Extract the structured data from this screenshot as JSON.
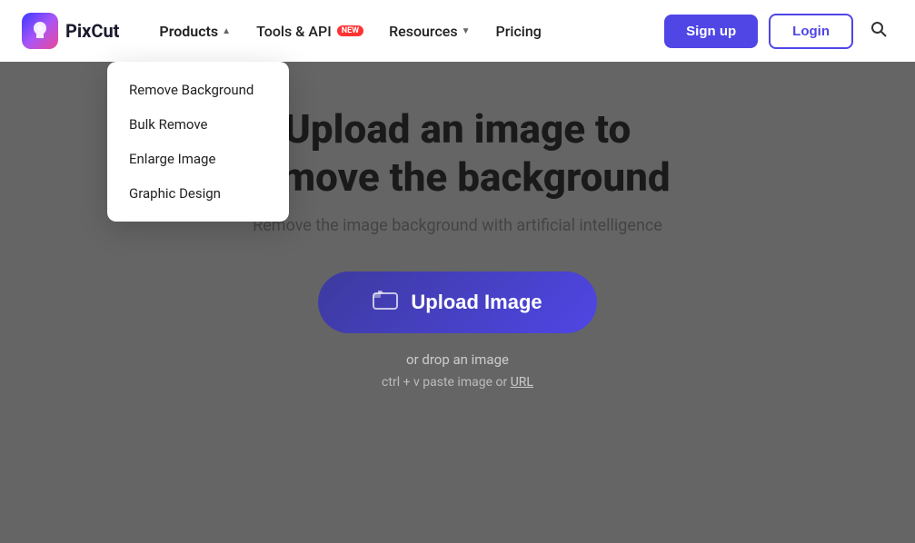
{
  "brand": {
    "logo_letter": "P",
    "name": "PixCut"
  },
  "navbar": {
    "products_label": "Products",
    "tools_label": "Tools & API",
    "tools_badge": "NEW",
    "resources_label": "Resources",
    "pricing_label": "Pricing",
    "signup_label": "Sign up",
    "login_label": "Login"
  },
  "dropdown": {
    "items": [
      {
        "label": "Remove Background"
      },
      {
        "label": "Bulk Remove"
      },
      {
        "label": "Enlarge Image"
      },
      {
        "label": "Graphic Design"
      }
    ]
  },
  "hero": {
    "title_line1": "Upload an image to",
    "title_line2": "remove the background",
    "subtitle": "Remove the image background with artificial intelligence"
  },
  "upload": {
    "button_label": "Upload Image",
    "drop_text": "or drop an image",
    "ctrl_text": "ctrl + v paste image or",
    "url_label": "URL"
  }
}
